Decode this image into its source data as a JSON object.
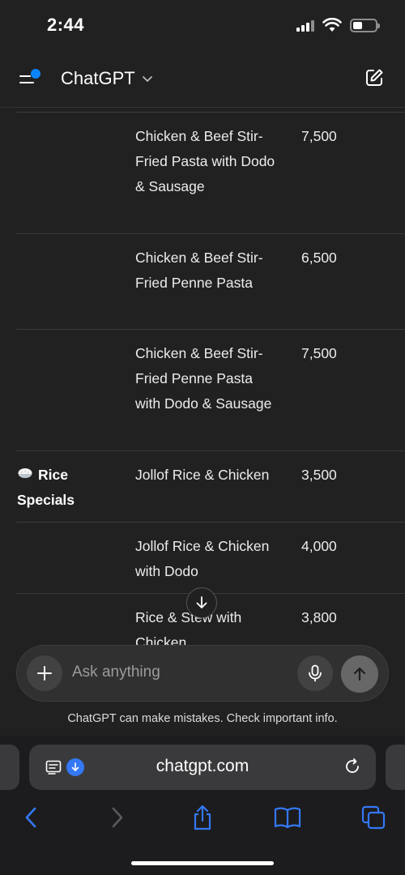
{
  "status_bar": {
    "time": "2:44"
  },
  "header": {
    "title": "ChatGPT"
  },
  "menu": {
    "rows": [
      {
        "category": "",
        "item": "Chicken & Beef Stir-Fried Pasta with Dodo & Sausage",
        "price": "7,500"
      },
      {
        "category": "",
        "item": "Chicken & Beef Stir-Fried Penne Pasta",
        "price": "6,500"
      },
      {
        "category": "",
        "item": "Chicken & Beef Stir-Fried Penne Pasta with Dodo & Sausage",
        "price": "7,500"
      },
      {
        "category": "Rice Specials",
        "category_icon": "rice-bowl-icon",
        "item": "Jollof Rice & Chicken",
        "price": "3,500"
      },
      {
        "category": "",
        "item": "Jollof Rice & Chicken with Dodo",
        "price": "4,000"
      },
      {
        "category": "",
        "item": "Rice & Stew with Chicken",
        "price": "3,800"
      }
    ]
  },
  "composer": {
    "placeholder": "Ask anything"
  },
  "disclaimer": "ChatGPT can make mistakes. Check important info.",
  "browser": {
    "url": "chatgpt.com"
  },
  "colors": {
    "background": "#212121",
    "accent": "#0a84ff",
    "safari_link": "#3478f6"
  }
}
